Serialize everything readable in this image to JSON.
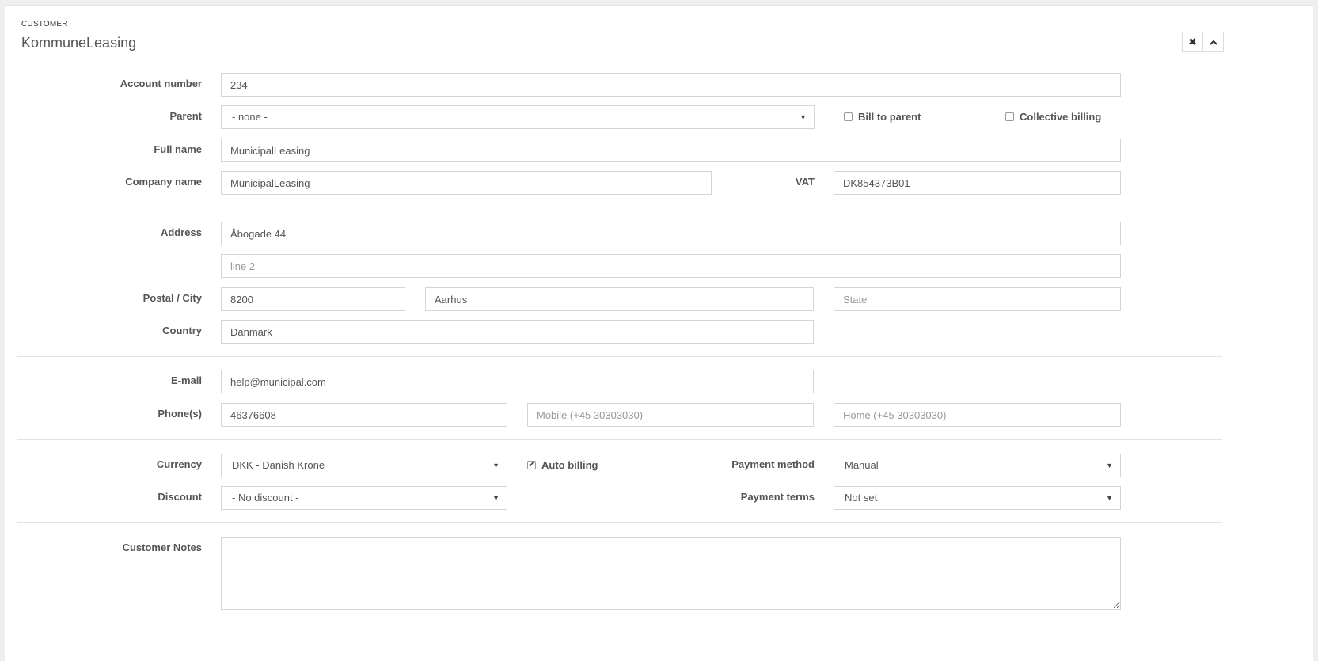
{
  "header": {
    "subtitle": "CUSTOMER",
    "title": "KommuneLeasing",
    "close_icon": "close-icon",
    "collapse_icon": "chevron-up-icon"
  },
  "labels": {
    "account_number": "Account number",
    "parent": "Parent",
    "full_name": "Full name",
    "company_name": "Company name",
    "vat": "VAT",
    "address": "Address",
    "postal_city": "Postal / City",
    "country": "Country",
    "email": "E-mail",
    "phones": "Phone(s)",
    "currency": "Currency",
    "payment_method": "Payment method",
    "discount": "Discount",
    "payment_terms": "Payment terms",
    "customer_notes": "Customer Notes"
  },
  "fields": {
    "account_number": "234",
    "parent": "- none -",
    "bill_to_parent": {
      "label": "Bill to parent",
      "checked": false
    },
    "collective_billing": {
      "label": "Collective billing",
      "checked": false
    },
    "full_name": "MunicipalLeasing",
    "company_name": "MunicipalLeasing",
    "vat": "DK854373B01",
    "address_line1": "Åbogade 44",
    "address_line2": {
      "value": "",
      "placeholder": "line 2"
    },
    "postal": "8200",
    "city": "Aarhus",
    "state": {
      "value": "",
      "placeholder": "State"
    },
    "country": "Danmark",
    "email": "help@municipal.com",
    "phone": "46376608",
    "mobile": {
      "value": "",
      "placeholder": "Mobile (+45 30303030)"
    },
    "home": {
      "value": "",
      "placeholder": "Home (+45 30303030)"
    },
    "currency": "DKK - Danish Krone",
    "auto_billing": {
      "label": "Auto billing",
      "checked": true
    },
    "payment_method": "Manual",
    "discount": "- No discount -",
    "payment_terms": "Not set",
    "customer_notes": ""
  }
}
